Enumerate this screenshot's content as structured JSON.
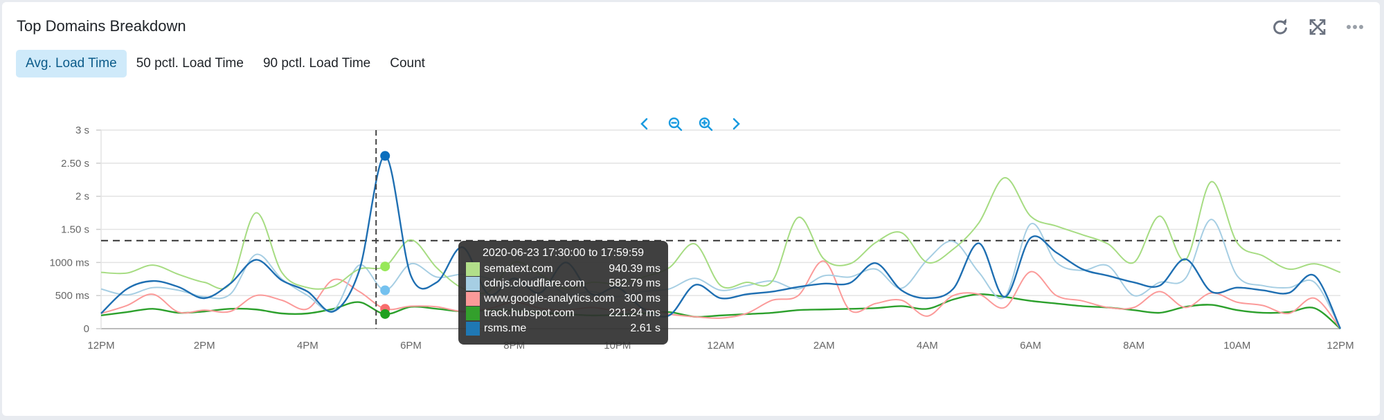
{
  "panel": {
    "title": "Top Domains Breakdown",
    "actions": [
      {
        "name": "refresh-icon",
        "glyph": "⟳"
      },
      {
        "name": "expand-icon",
        "glyph": "⤢"
      },
      {
        "name": "more-icon",
        "glyph": "•••"
      }
    ]
  },
  "tabs": [
    {
      "label": "Avg. Load Time",
      "active": true
    },
    {
      "label": "50 pctl. Load Time",
      "active": false
    },
    {
      "label": "90 pctl. Load Time",
      "active": false
    },
    {
      "label": "Count",
      "active": false
    }
  ],
  "tooltip": {
    "title": "2020-06-23 17:30:00 to 17:59:59",
    "rows": [
      {
        "name": "sematext.com",
        "value": "940.39 ms",
        "color": "#b2df8a"
      },
      {
        "name": "cdnjs.cloudflare.com",
        "value": "582.79 ms",
        "color": "#a6cee3"
      },
      {
        "name": "www.google-analytics.com",
        "value": "300 ms",
        "color": "#fb9a99"
      },
      {
        "name": "track.hubspot.com",
        "value": "221.24 ms",
        "color": "#33a02c"
      },
      {
        "name": "rsms.me",
        "value": "2.61 s",
        "color": "#1f78b4"
      }
    ]
  },
  "chart_data": {
    "type": "line",
    "title": "",
    "xlabel": "",
    "ylabel": "",
    "x_tick_labels": [
      "12PM",
      "2PM",
      "4PM",
      "6PM",
      "8PM",
      "10PM",
      "12AM",
      "2AM",
      "4AM",
      "6AM",
      "8AM",
      "10AM",
      "12PM"
    ],
    "y_tick_labels": [
      "0",
      "500 ms",
      "1000 ms",
      "1.50 s",
      "2 s",
      "2.50 s",
      "3 s"
    ],
    "ylim_ms": [
      0,
      3000
    ],
    "x_interval_minutes": 30,
    "x_points": 49,
    "threshold_ms": 1330,
    "crosshair_index": 11,
    "grid": true,
    "legend": "none",
    "series": [
      {
        "name": "sematext.com",
        "color": "#a6dc82",
        "values": [
          850,
          840,
          960,
          820,
          700,
          680,
          1750,
          850,
          620,
          640,
          900,
          940,
          1340,
          920,
          610,
          560,
          1000,
          820,
          600,
          700,
          680,
          780,
          920,
          1280,
          650,
          700,
          720,
          1680,
          1050,
          980,
          1300,
          1450,
          1000,
          1200,
          1600,
          2280,
          1700,
          1550,
          1420,
          1280,
          1000,
          1700,
          1040,
          2220,
          1300,
          1100,
          900,
          980,
          850
        ]
      },
      {
        "name": "cdnjs.cloudflare.com",
        "color": "#a6cee3",
        "values": [
          600,
          510,
          620,
          580,
          480,
          520,
          1120,
          750,
          500,
          280,
          960,
          580,
          980,
          780,
          820,
          760,
          620,
          780,
          520,
          560,
          480,
          560,
          600,
          760,
          580,
          650,
          720,
          600,
          800,
          780,
          900,
          610,
          1040,
          1320,
          850,
          480,
          1580,
          1000,
          880,
          950,
          500,
          700,
          760,
          1650,
          800,
          650,
          620,
          700,
          0
        ]
      },
      {
        "name": "www.google-analytics.com",
        "color": "#fb9a99",
        "values": [
          230,
          350,
          520,
          250,
          280,
          260,
          500,
          430,
          300,
          740,
          560,
          300,
          340,
          330,
          260,
          300,
          400,
          310,
          280,
          320,
          270,
          300,
          220,
          180,
          160,
          230,
          430,
          500,
          1020,
          280,
          380,
          430,
          190,
          500,
          520,
          320,
          860,
          500,
          420,
          320,
          320,
          560,
          320,
          540,
          400,
          350,
          230,
          460,
          0
        ]
      },
      {
        "name": "track.hubspot.com",
        "color": "#2ca02c",
        "values": [
          200,
          250,
          300,
          240,
          260,
          300,
          290,
          230,
          230,
          300,
          400,
          221,
          330,
          300,
          260,
          280,
          270,
          240,
          220,
          200,
          210,
          230,
          250,
          180,
          200,
          220,
          240,
          280,
          290,
          300,
          310,
          340,
          300,
          440,
          520,
          480,
          420,
          380,
          340,
          320,
          280,
          240,
          330,
          360,
          280,
          240,
          250,
          310,
          0
        ]
      },
      {
        "name": "rsms.me",
        "color": "#1f6fb2",
        "values": [
          230,
          600,
          720,
          630,
          460,
          680,
          1040,
          730,
          560,
          260,
          880,
          2610,
          800,
          700,
          1230,
          520,
          760,
          540,
          1000,
          520,
          620,
          300,
          200,
          660,
          460,
          520,
          560,
          630,
          680,
          690,
          990,
          580,
          460,
          600,
          1290,
          480,
          1370,
          1150,
          900,
          800,
          700,
          650,
          1050,
          560,
          620,
          580,
          540,
          800,
          0
        ]
      }
    ]
  }
}
